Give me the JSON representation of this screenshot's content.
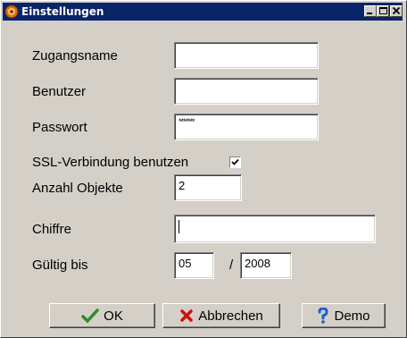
{
  "window": {
    "title": "Einstellungen",
    "controls": {
      "minimize": "minimize-icon",
      "maximize": "maximize-icon",
      "close": "close-icon"
    }
  },
  "form": {
    "account_name": {
      "label": "Zugangsname",
      "value": ""
    },
    "user": {
      "label": "Benutzer",
      "value": ""
    },
    "password": {
      "label": "Passwort",
      "value": "*******"
    },
    "ssl": {
      "label": "SSL-Verbindung benutzen",
      "checked": true
    },
    "object_count": {
      "label": "Anzahl Objekte",
      "value": "2"
    },
    "cipher": {
      "label": "Chiffre",
      "value": ""
    },
    "valid_until": {
      "label": "Gültig bis",
      "month": "05",
      "separator": "/",
      "year": "2008"
    }
  },
  "buttons": {
    "ok": {
      "label": "OK",
      "icon": "checkmark-icon"
    },
    "cancel": {
      "label": "Abbrechen",
      "icon": "red-x-icon"
    },
    "demo": {
      "label": "Demo",
      "icon": "question-mark-icon"
    }
  },
  "colors": {
    "titlebar": "#0a246a",
    "face": "#d4d0c8",
    "ok_icon": "#2e8b2e",
    "cancel_icon": "#d01010",
    "demo_icon": "#1a5fd0"
  }
}
